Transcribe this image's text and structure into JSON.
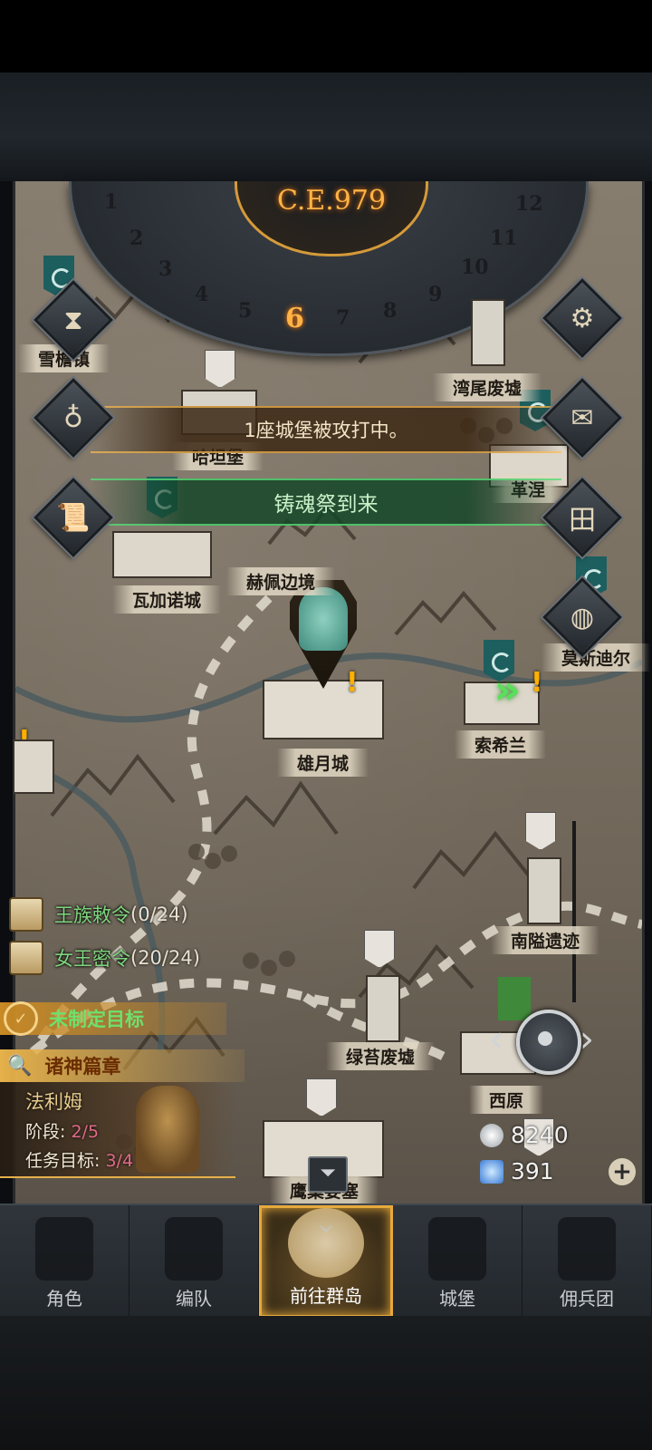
{
  "calendar": {
    "year": "C.E.979",
    "months": [
      "1",
      "2",
      "3",
      "4",
      "5",
      "6",
      "7",
      "8",
      "9",
      "10",
      "11",
      "12"
    ],
    "current_month": "6"
  },
  "notices": {
    "siege": "1座城堡被攻打中。",
    "festival": "铸魂祭到来"
  },
  "locations": {
    "xueyanzhen": "雪檐镇",
    "wanwei": "湾尾废墟",
    "hajibao": "哈坦堡",
    "gesheng": "革涅",
    "wajianuo": "瓦加诺城",
    "hepei": "赫佩边境",
    "mosidier": "莫斯迪尔",
    "xiongyue": "雄月城",
    "suoxilan": "索希兰",
    "nanyi": "南隘遗迹",
    "lvtai": "绿苔废墟",
    "xiyuan": "西原",
    "yingchao": "鹰巢要塞"
  },
  "quests": [
    {
      "title": "王族敕令",
      "count": "(0/24)"
    },
    {
      "title": "女王密令",
      "count": "(20/24)"
    }
  ],
  "goal": "未制定目标",
  "chapter": {
    "title": "诸神篇章",
    "name": "法利姆",
    "stage_label": "阶段:",
    "stage_value": "2/5",
    "target_label": "任务目标:",
    "target_value": "3/4"
  },
  "resources": {
    "silver": "8240",
    "crystal": "391"
  },
  "side_buttons": [
    "hourglass-icon",
    "bag-icon",
    "scroll-icon",
    "gear-icon",
    "mail-icon",
    "grid-icon",
    "shield-icon"
  ],
  "nav": {
    "items": [
      "角色",
      "编队",
      "前往群岛",
      "城堡",
      "佣兵团"
    ],
    "active_index": 2
  },
  "colors": {
    "accent_gold": "#e7a93c",
    "quest_green": "#7ed67e",
    "progress_pink": "#e06a8a"
  }
}
